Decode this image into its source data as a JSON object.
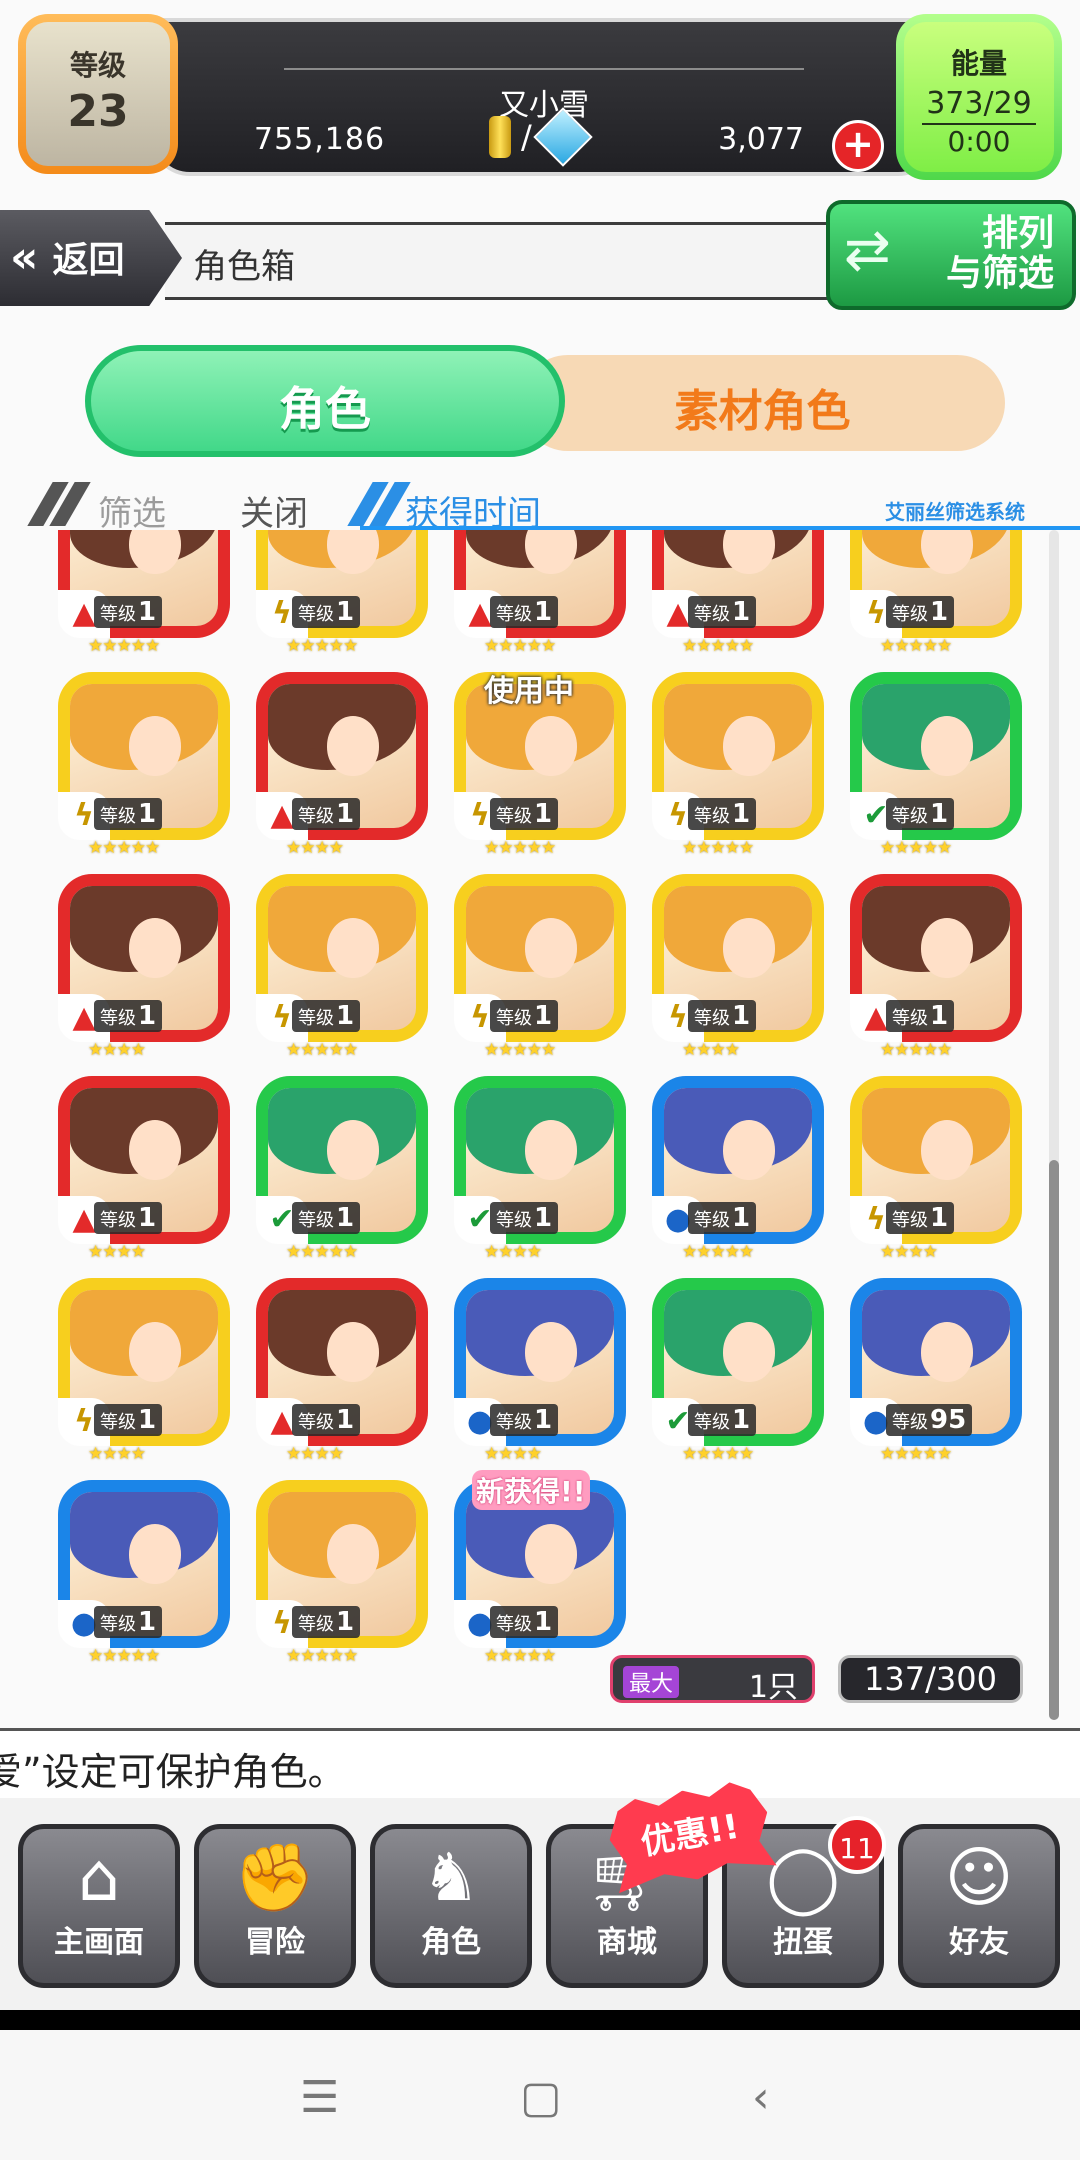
{
  "header": {
    "level_label": "等级",
    "level_value": "23",
    "player_name": "又小雪",
    "coins": "755,186",
    "currency_slash": "/",
    "gems": "3,077",
    "energy_label": "能量",
    "energy_value": "373/29",
    "energy_timer": "0:00"
  },
  "toolbar": {
    "back_label": "返回",
    "title": "角色箱",
    "sort_label_line1": "排列",
    "sort_label_line2": "与筛选"
  },
  "tabs": [
    {
      "label": "角色",
      "active": true
    },
    {
      "label": "素材角色",
      "active": false
    }
  ],
  "filter": {
    "screen_label": "筛选",
    "close_label": "关闭",
    "order_label": "获得时间",
    "system_label": "艾丽丝筛选系统"
  },
  "cards": [
    {
      "color": "red",
      "elem": "fire",
      "level_label": "等级",
      "level": "1",
      "stars": "★★★★★"
    },
    {
      "color": "yellow",
      "elem": "light",
      "level_label": "等级",
      "level": "1",
      "stars": "★★★★★"
    },
    {
      "color": "red",
      "elem": "fire",
      "level_label": "等级",
      "level": "1",
      "stars": "★★★★★"
    },
    {
      "color": "red",
      "elem": "fire",
      "level_label": "等级",
      "level": "1",
      "stars": "★★★★★"
    },
    {
      "color": "yellow",
      "elem": "light",
      "level_label": "等级",
      "level": "1",
      "stars": "★★★★★"
    },
    {
      "color": "yellow",
      "elem": "light",
      "level_label": "等级",
      "level": "1",
      "stars": "★★★★★"
    },
    {
      "color": "red",
      "elem": "fire",
      "level_label": "等级",
      "level": "1",
      "stars": "★★★★"
    },
    {
      "color": "yellow",
      "elem": "light",
      "level_label": "等级",
      "level": "1",
      "stars": "★★★★★",
      "tag": "使用中"
    },
    {
      "color": "yellow",
      "elem": "light",
      "level_label": "等级",
      "level": "1",
      "stars": "★★★★★"
    },
    {
      "color": "green",
      "elem": "wood",
      "level_label": "等级",
      "level": "1",
      "stars": "★★★★★"
    },
    {
      "color": "red",
      "elem": "fire",
      "level_label": "等级",
      "level": "1",
      "stars": "★★★★"
    },
    {
      "color": "yellow",
      "elem": "light",
      "level_label": "等级",
      "level": "1",
      "stars": "★★★★★"
    },
    {
      "color": "yellow",
      "elem": "light",
      "level_label": "等级",
      "level": "1",
      "stars": "★★★★★"
    },
    {
      "color": "yellow",
      "elem": "light",
      "level_label": "等级",
      "level": "1",
      "stars": "★★★★"
    },
    {
      "color": "red",
      "elem": "fire",
      "level_label": "等级",
      "level": "1",
      "stars": "★★★★★"
    },
    {
      "color": "red",
      "elem": "fire",
      "level_label": "等级",
      "level": "1",
      "stars": "★★★★"
    },
    {
      "color": "green",
      "elem": "wood",
      "level_label": "等级",
      "level": "1",
      "stars": "★★★★★"
    },
    {
      "color": "green",
      "elem": "wood",
      "level_label": "等级",
      "level": "1",
      "stars": "★★★★"
    },
    {
      "color": "blue",
      "elem": "water",
      "level_label": "等级",
      "level": "1",
      "stars": "★★★★★"
    },
    {
      "color": "yellow",
      "elem": "light",
      "level_label": "等级",
      "level": "1",
      "stars": "★★★★"
    },
    {
      "color": "yellow",
      "elem": "light",
      "level_label": "等级",
      "level": "1",
      "stars": "★★★★"
    },
    {
      "color": "red",
      "elem": "fire",
      "level_label": "等级",
      "level": "1",
      "stars": "★★★★"
    },
    {
      "color": "blue",
      "elem": "water",
      "level_label": "等级",
      "level": "1",
      "stars": "★★★★"
    },
    {
      "color": "green",
      "elem": "wood",
      "level_label": "等级",
      "level": "1",
      "stars": "★★★★★"
    },
    {
      "color": "blue",
      "elem": "water",
      "level_label": "等级",
      "level": "95",
      "stars": "★★★★★"
    },
    {
      "color": "blue",
      "elem": "water",
      "level_label": "等级",
      "level": "1",
      "stars": "★★★★★"
    },
    {
      "color": "yellow",
      "elem": "light",
      "level_label": "等级",
      "level": "1",
      "stars": "★★★★★"
    },
    {
      "color": "blue",
      "elem": "water",
      "level_label": "等级",
      "level": "1",
      "stars": "★★★★★",
      "tag": "新获得!!"
    }
  ],
  "counters": {
    "max_label": "最大",
    "max_value": "1只",
    "total": "137/300"
  },
  "ticker": "爱”设定可保护角色。",
  "nav": {
    "promo": "优惠!!",
    "badge_count": "11",
    "items": [
      {
        "label": "主画面",
        "icon": "home-icon"
      },
      {
        "label": "冒险",
        "icon": "handshake-icon"
      },
      {
        "label": "角色",
        "icon": "rabbit-icon"
      },
      {
        "label": "商城",
        "icon": "cart-icon"
      },
      {
        "label": "扭蛋",
        "icon": "egg-icon"
      },
      {
        "label": "好友",
        "icon": "friends-icon"
      }
    ]
  },
  "colors": {
    "red": "#e32a2a",
    "yellow": "#f7cf1e",
    "green": "#25c94a",
    "blue": "#1b85e8"
  }
}
